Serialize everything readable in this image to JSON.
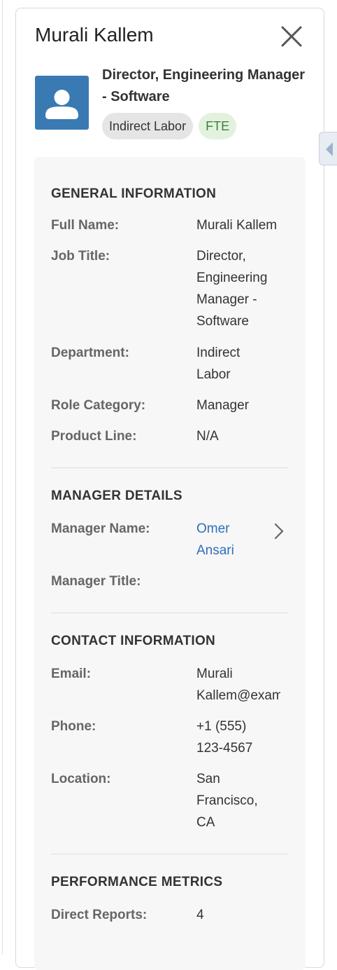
{
  "profile": {
    "name": "Murali Kallem",
    "job_heading": "Director, Engineering Manager - Software",
    "badges": {
      "department": "Indirect Labor",
      "employment_type": "FTE"
    }
  },
  "icons": {
    "close": "close-icon",
    "avatar": "user-avatar-icon",
    "chevron": "chevron-right-icon",
    "collapse": "chevron-left-icon"
  },
  "colors": {
    "avatar_bg": "#3a7ab3",
    "link": "#2f6fb8",
    "fte_badge_bg": "#e3f2df",
    "fte_badge_text": "#3f7f3c",
    "details_bg": "#f7f7f7"
  },
  "general": {
    "title": "GENERAL INFORMATION",
    "full_name_label": "Full Name:",
    "full_name": "Murali Kallem",
    "job_title_label": "Job Title:",
    "job_title": "Director, Engineering Manager - Software",
    "department_label": "Department:",
    "department": "Indirect Labor",
    "role_category_label": "Role Category:",
    "role_category": "Manager",
    "product_line_label": "Product Line:",
    "product_line": "N/A"
  },
  "manager": {
    "title": "MANAGER DETAILS",
    "name_label": "Manager Name:",
    "name": "Omer Ansari",
    "title_label": "Manager Title:",
    "manager_title": ""
  },
  "contact": {
    "title": "CONTACT INFORMATION",
    "email_label": "Email:",
    "email": "Murali Kallem@example.com",
    "phone_label": "Phone:",
    "phone": "+1 (555) 123-4567",
    "location_label": "Location:",
    "location": "San Francisco, CA"
  },
  "performance": {
    "title": "PERFORMANCE METRICS",
    "direct_reports_label": "Direct Reports:",
    "direct_reports": "4"
  }
}
